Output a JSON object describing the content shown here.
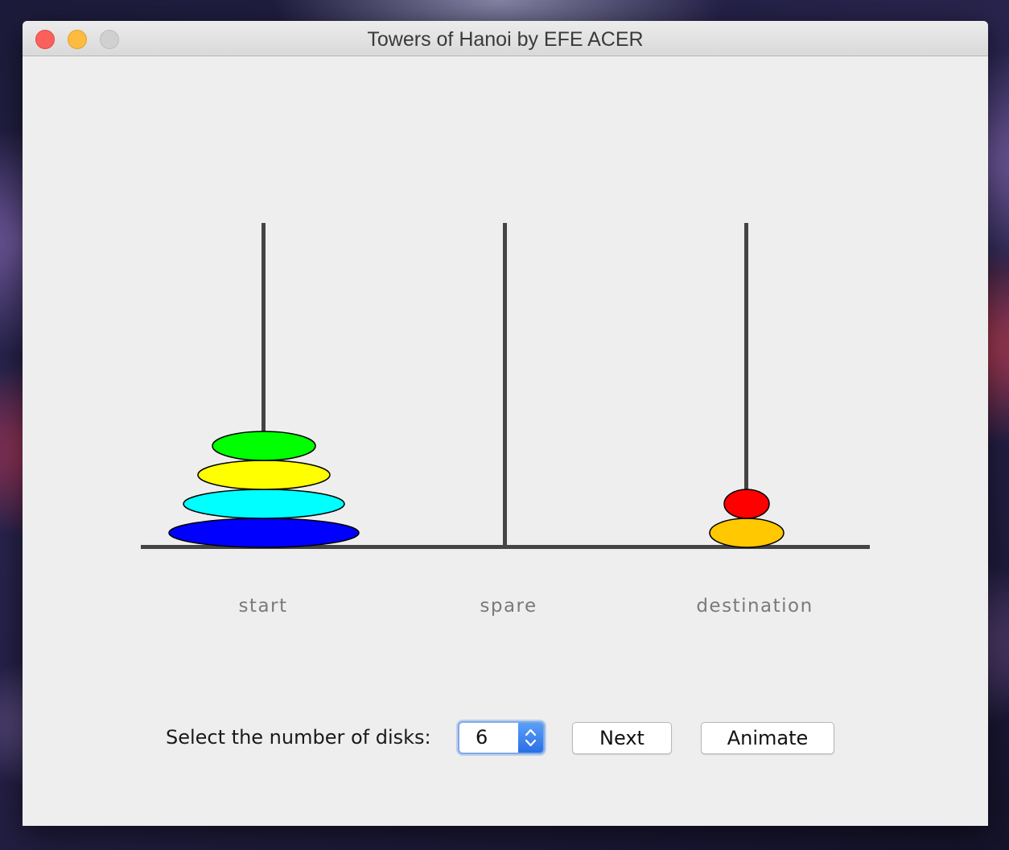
{
  "window": {
    "title": "Towers of Hanoi by EFE ACER"
  },
  "pegs": [
    {
      "label": "start",
      "disks": [
        {
          "color": "#0000ff",
          "size": 6
        },
        {
          "color": "#00ffff",
          "size": 5
        },
        {
          "color": "#ffff00",
          "size": 4
        },
        {
          "color": "#00ff00",
          "size": 3
        }
      ]
    },
    {
      "label": "spare",
      "disks": []
    },
    {
      "label": "destination",
      "disks": [
        {
          "color": "#ffc800",
          "size": 2
        },
        {
          "color": "#ff0000",
          "size": 1
        }
      ]
    }
  ],
  "colors": {
    "peg": "#444444",
    "disk_outline": "#000000",
    "label": "#7a7a7a",
    "window_bg": "#eeeeee",
    "spinner_accent": "#2a6ee6"
  },
  "controls": {
    "disks_label": "Select the number of disks:",
    "disks_value": "6",
    "next_label": "Next",
    "animate_label": "Animate"
  }
}
